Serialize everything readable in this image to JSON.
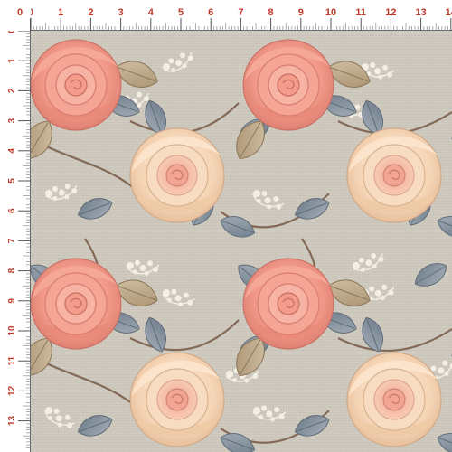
{
  "ruler": {
    "unit_labels_top": [
      "0",
      "1",
      "2",
      "3",
      "4",
      "5",
      "6",
      "7",
      "8",
      "9",
      "10",
      "11",
      "12",
      "13",
      "14"
    ],
    "unit_labels_left": [
      "0",
      "1",
      "2",
      "3",
      "4",
      "5",
      "6",
      "7",
      "8",
      "9",
      "10",
      "11",
      "12",
      "13"
    ],
    "label_color": "#c0392b",
    "zero_marker": "0"
  },
  "pattern": {
    "background_color": "#c9c3b6",
    "peach_rose_color": "#f29a8a",
    "cream_rose_color": "#f7dcc0",
    "leaf_color": "#8e9aa6",
    "lace_color": "#f3efe6",
    "stem_color": "#6b4a34"
  }
}
